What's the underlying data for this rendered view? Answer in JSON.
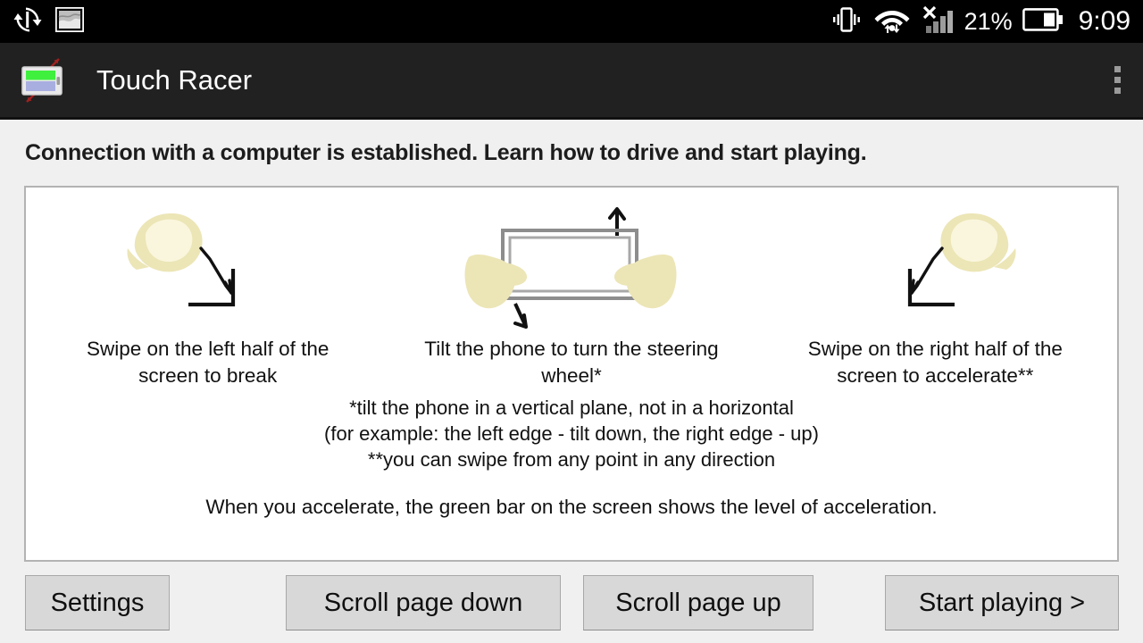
{
  "status_bar": {
    "icons_left": [
      "sync-icon",
      "gallery-icon"
    ],
    "icons_right": [
      "vibrate-icon",
      "wifi-transfer-icon",
      "signal-no-service-icon",
      "battery-icon"
    ],
    "battery_percent": "21%",
    "clock": "9:09"
  },
  "action_bar": {
    "app_icon": "touch-racer-icon",
    "title": "Touch Racer",
    "overflow": "overflow-menu-icon"
  },
  "main": {
    "headline": "Connection with a computer is established. Learn how to drive and start playing.",
    "panels": [
      {
        "art": "hand-swipe-down-right-icon",
        "caption": "Swipe on the left half of the screen to break"
      },
      {
        "art": "two-hands-tilting-phone-icon",
        "caption": "Tilt the phone to turn the steering wheel*"
      },
      {
        "art": "hand-swipe-down-left-icon",
        "caption": "Swipe on the right half of the screen to accelerate**"
      }
    ],
    "footnotes": [
      "*tilt the phone in a vertical plane, not in a horizontal",
      "(for example: the left edge - tilt down, the right edge - up)",
      "**you can swipe from any point in any direction"
    ],
    "final_note": "When you accelerate, the green bar on the screen shows the level of acceleration."
  },
  "buttons": {
    "settings": "Settings",
    "scroll_down": "Scroll page down",
    "scroll_up": "Scroll page up",
    "start_playing": "Start playing >"
  },
  "colors": {
    "status_bar_bg": "#000000",
    "action_bar_bg": "#212121",
    "page_bg": "#f0f0f0",
    "card_bg": "#ffffff",
    "card_border": "#b3b3b3",
    "button_bg": "#d8d8d8",
    "hand_fill": "#ece5b6",
    "icon_green": "#3ff03f",
    "icon_purple": "#a9aee0",
    "accent_red": "#a32020"
  }
}
